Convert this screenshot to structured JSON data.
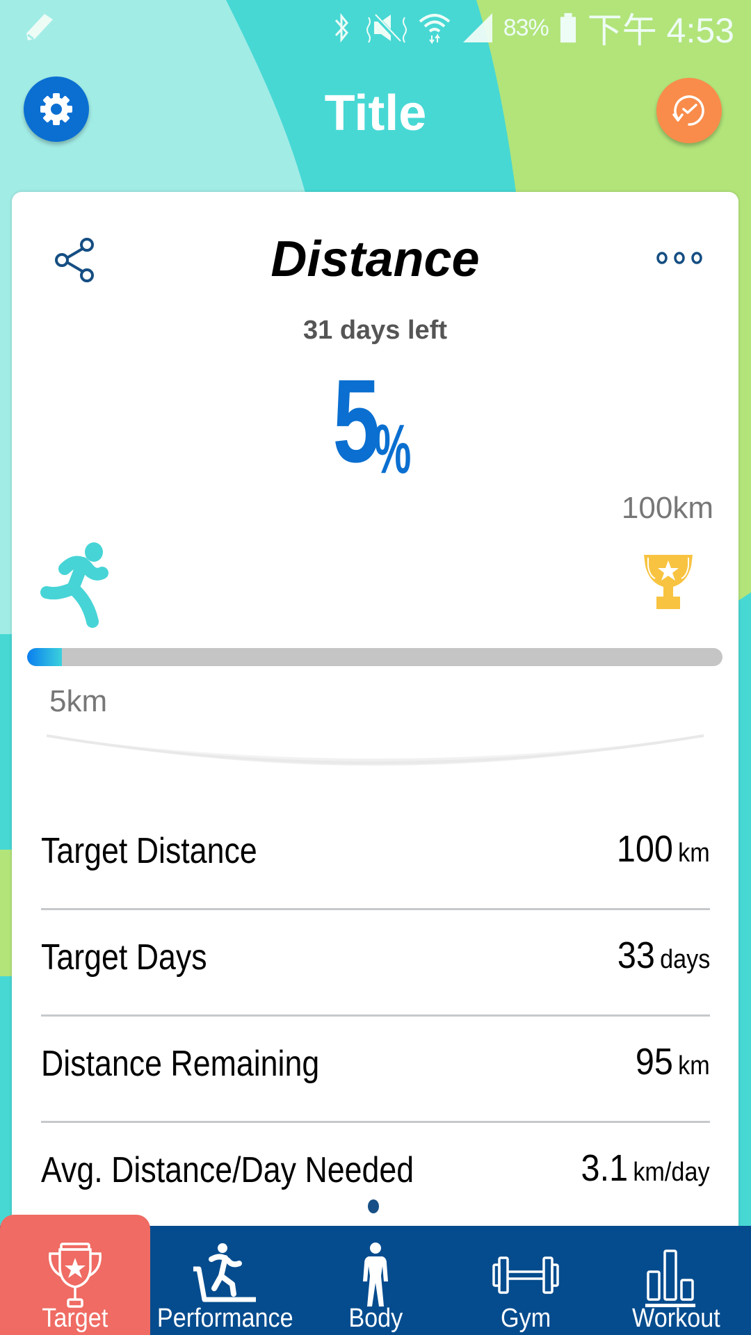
{
  "status_bar": {
    "battery_percent": "83%",
    "time": "下午 4:53",
    "icons": [
      "pencil-icon",
      "bluetooth-icon",
      "vibrate-mute-icon",
      "wifi-icon",
      "signal-icon",
      "battery-icon"
    ]
  },
  "header": {
    "title": "Title",
    "left_button_icon": "gear-icon",
    "right_button_icon": "history-icon"
  },
  "colors": {
    "bg_light_teal": "#a2ece6",
    "bg_teal": "#47d8d4",
    "bg_green": "#b2e47a",
    "accent_blue": "#0a6fd0",
    "settings_blue": "#0b6fd2",
    "history_orange": "#f98c4b",
    "runner_teal": "#47d4d6",
    "trophy_gold": "#f8c340",
    "tabbar_navy": "#054c8e",
    "tab_active_red": "#ef6b63"
  },
  "card": {
    "title": "Distance",
    "days_left": "31 days left",
    "percent_value": "5",
    "percent_sign": "%",
    "goal_label": "100km",
    "current_label": "5km",
    "progress_fraction": 0.05,
    "stats": [
      {
        "label": "Target Distance",
        "value": "100",
        "unit": "km"
      },
      {
        "label": "Target Days",
        "value": "33",
        "unit": "days"
      },
      {
        "label": "Distance Remaining",
        "value": "95",
        "unit": "km"
      },
      {
        "label": "Avg. Distance/Day Needed",
        "value": "3.1",
        "unit": "km/day"
      }
    ]
  },
  "tabs": [
    {
      "label": "Target",
      "icon": "trophy-icon",
      "active": true
    },
    {
      "label": "Performance",
      "icon": "treadmill-runner-icon",
      "active": false
    },
    {
      "label": "Body",
      "icon": "body-icon",
      "active": false
    },
    {
      "label": "Gym",
      "icon": "dumbbell-icon",
      "active": false
    },
    {
      "label": "Workout",
      "icon": "bar-chart-icon",
      "active": false
    }
  ]
}
